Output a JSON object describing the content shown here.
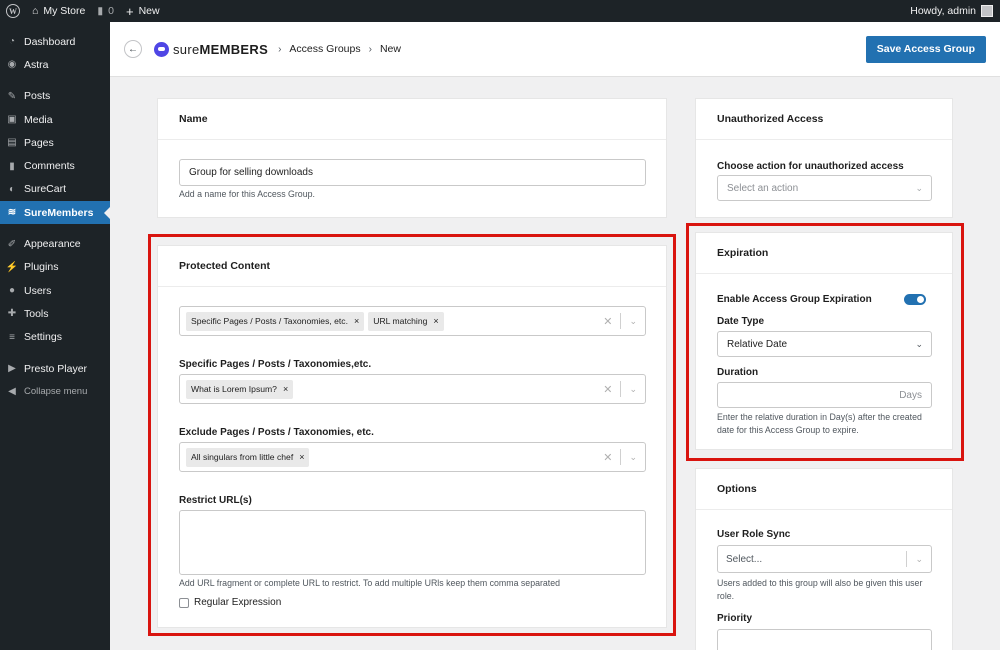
{
  "adminbar": {
    "site_name": "My Store",
    "comments_count": "0",
    "new_label": "New",
    "howdy": "Howdy, admin"
  },
  "sidebar": {
    "items": [
      {
        "label": "Dashboard",
        "icon": "dashboard-icon"
      },
      {
        "label": "Astra",
        "icon": "astra-icon"
      },
      {
        "label": "Posts",
        "icon": "pin-icon"
      },
      {
        "label": "Media",
        "icon": "media-icon"
      },
      {
        "label": "Pages",
        "icon": "pages-icon"
      },
      {
        "label": "Comments",
        "icon": "comment-icon"
      },
      {
        "label": "SureCart",
        "icon": "surecart-icon"
      },
      {
        "label": "SureMembers",
        "icon": "suremembers-icon"
      },
      {
        "label": "Appearance",
        "icon": "brush-icon"
      },
      {
        "label": "Plugins",
        "icon": "plugin-icon"
      },
      {
        "label": "Users",
        "icon": "users-icon"
      },
      {
        "label": "Tools",
        "icon": "wrench-icon"
      },
      {
        "label": "Settings",
        "icon": "settings-icon"
      },
      {
        "label": "Presto Player",
        "icon": "play-icon"
      },
      {
        "label": "Collapse menu",
        "icon": "collapse-icon"
      }
    ]
  },
  "header": {
    "logo_light": "sure",
    "logo_bold": "MEMBERS",
    "crumb_1": "Access Groups",
    "crumb_2": "New",
    "save_label": "Save Access Group"
  },
  "name_panel": {
    "title": "Name",
    "value": "Group for selling downloads",
    "help": "Add a name for this Access Group."
  },
  "protected": {
    "title": "Protected Content",
    "rules": [
      "Specific Pages / Posts / Taxonomies, etc.",
      "URL matching"
    ],
    "specific_label": "Specific Pages / Posts / Taxonomies,etc.",
    "specific_items": [
      "What is Lorem Ipsum?"
    ],
    "exclude_label": "Exclude Pages / Posts / Taxonomies, etc.",
    "exclude_items": [
      "All singulars from little chef"
    ],
    "restrict_label": "Restrict URL(s)",
    "restrict_help": "Add URL fragment or complete URL to restrict. To add multiple URls keep them comma separated",
    "regex_label": "Regular Expression"
  },
  "unauthorized": {
    "title": "Unauthorized Access",
    "action_label": "Choose action for unauthorized access",
    "action_placeholder": "Select an action"
  },
  "expiration": {
    "title": "Expiration",
    "enable_label": "Enable Access Group Expiration",
    "enabled": true,
    "date_type_label": "Date Type",
    "date_type_value": "Relative Date",
    "duration_label": "Duration",
    "duration_unit": "Days",
    "help": "Enter the relative duration in Day(s) after the created date for this Access Group to expire."
  },
  "options": {
    "title": "Options",
    "role_sync_label": "User Role Sync",
    "role_sync_placeholder": "Select...",
    "role_sync_help": "Users added to this group will also be given this user role.",
    "priority_label": "Priority"
  },
  "colors": {
    "highlight": "#d9140f",
    "primary": "#2271b1",
    "admin_bg": "#1d2327"
  }
}
